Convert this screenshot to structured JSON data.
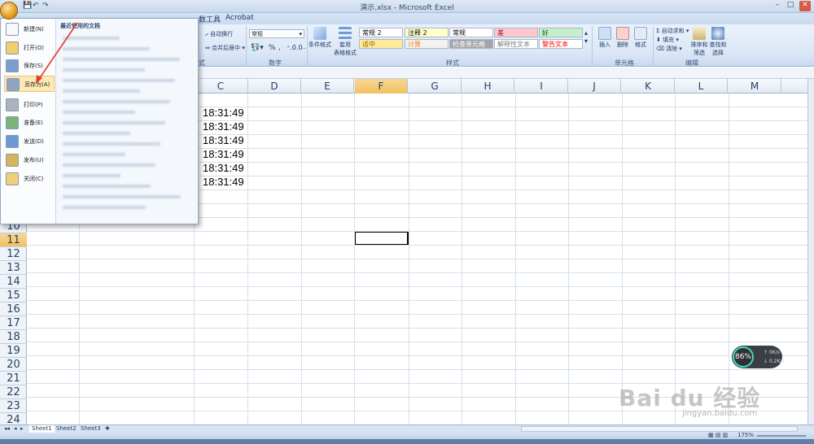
{
  "window": {
    "title": "演示.xlsx - Microsoft Excel",
    "min_icon": "minimize-icon",
    "max_icon": "maximize-icon",
    "close_icon": "close-icon"
  },
  "tabs": {
    "data_tools": "数工具",
    "acrobat": "Acrobat"
  },
  "ribbon": {
    "alignment": {
      "wrap_text": "自动换行",
      "merge_center": "合并后居中",
      "group": "式"
    },
    "number": {
      "format_value": "常规",
      "group": "数字"
    },
    "styles": {
      "conditional": "条件格式",
      "table_format": "套用\n表格格式",
      "cells": [
        {
          "text": "常规 2",
          "bg": "#ffffff",
          "color": "#000000"
        },
        {
          "text": "注释 2",
          "bg": "#ffffcc",
          "color": "#000000"
        },
        {
          "text": "常规",
          "bg": "#ffffff",
          "color": "#000000"
        },
        {
          "text": "差",
          "bg": "#ffc7ce",
          "color": "#9c0006"
        },
        {
          "text": "好",
          "bg": "#c6efce",
          "color": "#006100"
        },
        {
          "text": "适中",
          "bg": "#ffeb9c",
          "color": "#9c6500"
        },
        {
          "text": "计算",
          "bg": "#f2f2f2",
          "color": "#fa7d00"
        },
        {
          "text": "检查单元格",
          "bg": "#a5a5a5",
          "color": "#ffffff"
        },
        {
          "text": "解释性文本",
          "bg": "#ffffff",
          "color": "#7f7f7f"
        },
        {
          "text": "警告文本",
          "bg": "#ffffff",
          "color": "#ff0000"
        }
      ],
      "group": "样式"
    },
    "cells_group": {
      "insert": "插入",
      "delete": "删除",
      "format": "格式",
      "group": "单元格"
    },
    "editing": {
      "autosum": "自动求和",
      "fill": "填充",
      "clear": "清除",
      "sort_filter": "排序和\n筛选",
      "find_select": "查找和\n选择",
      "group": "编辑"
    }
  },
  "office_menu": {
    "items": [
      {
        "label": "新建(N)",
        "icon": "new-doc-icon"
      },
      {
        "label": "打开(O)",
        "icon": "open-folder-icon"
      },
      {
        "label": "保存(S)",
        "icon": "save-icon"
      },
      {
        "label": "另存为(A)",
        "icon": "save-as-icon"
      },
      {
        "label": "打印(P)",
        "icon": "print-icon"
      },
      {
        "label": "准备(E)",
        "icon": "prepare-icon"
      },
      {
        "label": "发送(D)",
        "icon": "send-icon"
      },
      {
        "label": "发布(U)",
        "icon": "publish-icon"
      },
      {
        "label": "关闭(C)",
        "icon": "close-folder-icon"
      }
    ],
    "recent_heading": "最近使用的文档"
  },
  "grid": {
    "columns": [
      "C",
      "D",
      "E",
      "F",
      "G",
      "H",
      "I",
      "J",
      "K",
      "L",
      "M"
    ],
    "active_column": "F",
    "rows": [
      "10",
      "11",
      "12",
      "13",
      "14",
      "15",
      "16",
      "17",
      "18",
      "19",
      "20",
      "21",
      "22",
      "23",
      "24"
    ],
    "active_row": "11",
    "c_values": [
      "18:31:49",
      "18:31:49",
      "18:31:49",
      "18:31:49",
      "18:31:49",
      "18:31:49"
    ]
  },
  "sheets": [
    "Sheet1",
    "Sheet2",
    "Sheet3"
  ],
  "status": {
    "zoom": "175%"
  },
  "speed_widget": {
    "percent": "86%",
    "up": "0",
    "up_unit": "K/s",
    "down": "0.2",
    "down_unit": "K/s"
  },
  "watermark": {
    "brand": "Bai du 经验",
    "url": "jingyan.baidu.com"
  }
}
